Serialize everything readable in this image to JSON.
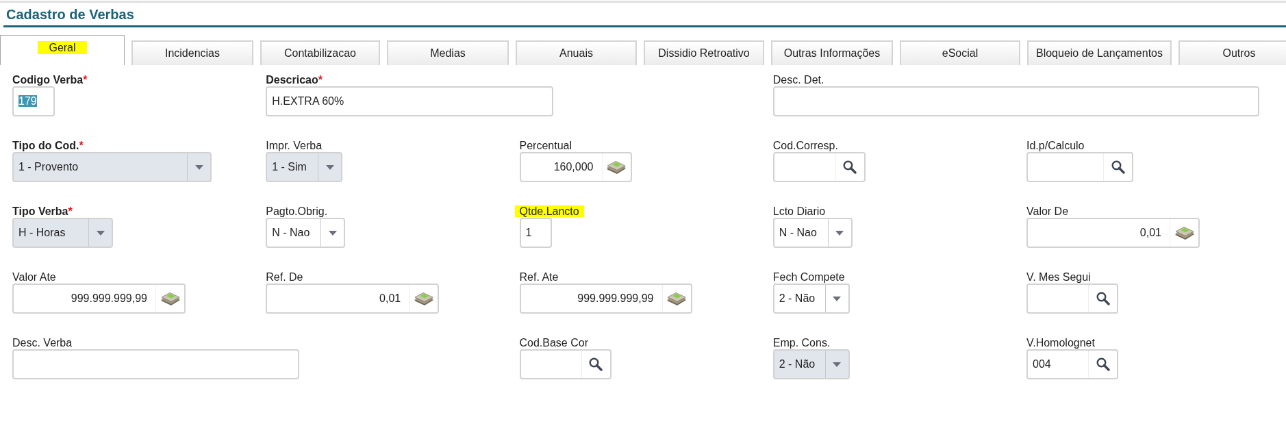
{
  "title": "Cadastro de Verbas",
  "tabs": [
    {
      "label": "Geral",
      "selected": true,
      "highlighted": true
    },
    {
      "label": "Incidencias",
      "selected": false,
      "highlighted": false
    },
    {
      "label": "Contabilizacao",
      "selected": false,
      "highlighted": false
    },
    {
      "label": "Medias",
      "selected": false,
      "highlighted": false
    },
    {
      "label": "Anuais",
      "selected": false,
      "highlighted": false
    },
    {
      "label": "Dissidio Retroativo",
      "selected": false,
      "highlighted": false
    },
    {
      "label": "Outras Informações",
      "selected": false,
      "highlighted": false
    },
    {
      "label": "eSocial",
      "selected": false,
      "highlighted": false
    },
    {
      "label": "Bloqueio de Lançamentos",
      "selected": false,
      "highlighted": false
    },
    {
      "label": "Outros",
      "selected": false,
      "highlighted": false
    }
  ],
  "form": {
    "fields": [
      {
        "kind": "text",
        "label": "Codigo Verba",
        "required": true,
        "required_mark": "*",
        "highlighted": false,
        "disabled": false,
        "value": "179",
        "value_selected": true
      },
      {
        "kind": "text",
        "label": "Descricao",
        "required": true,
        "required_mark": "*",
        "highlighted": false,
        "disabled": false,
        "value": "H.EXTRA 60%",
        "value_selected": false
      },
      {
        "kind": "text",
        "label": "Desc. Det.",
        "required": false,
        "highlighted": false,
        "disabled": false
      },
      {
        "kind": "select",
        "label": "Tipo do Cod.",
        "required": true,
        "required_mark": "*",
        "highlighted": false,
        "disabled": true,
        "value": "1 - Provento",
        "value_selected": false
      },
      {
        "kind": "select",
        "label": "Impr. Verba",
        "required": false,
        "highlighted": false,
        "disabled": true,
        "value": "1 - Sim",
        "value_selected": false
      },
      {
        "kind": "money",
        "label": "Percentual",
        "required": false,
        "highlighted": false,
        "disabled": false,
        "value": "160,000",
        "value_selected": false
      },
      {
        "kind": "lookup",
        "label": "Cod.Corresp.",
        "required": false,
        "highlighted": false,
        "disabled": false
      },
      {
        "kind": "lookup",
        "label": "Id.p/Calculo",
        "required": false,
        "highlighted": false,
        "disabled": false
      },
      {
        "kind": "select",
        "label": "Tipo Verba",
        "required": true,
        "required_mark": "*",
        "highlighted": false,
        "disabled": true,
        "value": "H - Horas",
        "value_selected": false
      },
      {
        "kind": "select",
        "label": "Pagto.Obrig.",
        "required": false,
        "highlighted": false,
        "disabled": false,
        "value": "N - Nao",
        "value_selected": false
      },
      {
        "kind": "text",
        "label": "Qtde.Lancto",
        "required": false,
        "highlighted": true,
        "disabled": false,
        "value": "1",
        "value_selected": false
      },
      {
        "kind": "select",
        "label": "Lcto Diario",
        "required": false,
        "highlighted": false,
        "disabled": false,
        "value": "N - Nao",
        "value_selected": false
      },
      {
        "kind": "money",
        "label": "Valor De",
        "required": false,
        "highlighted": false,
        "disabled": false,
        "value": "0,01",
        "value_selected": false
      },
      {
        "kind": "money",
        "label": "Valor Ate",
        "required": false,
        "highlighted": false,
        "disabled": false,
        "value": "999.999.999,99",
        "value_selected": false
      },
      {
        "kind": "money",
        "label": "Ref. De",
        "required": false,
        "highlighted": false,
        "disabled": false,
        "value": "0,01",
        "value_selected": false
      },
      {
        "kind": "money",
        "label": "Ref. Ate",
        "required": false,
        "highlighted": false,
        "disabled": false,
        "value": "999.999.999,99",
        "value_selected": false
      },
      {
        "kind": "select",
        "label": "Fech Compete",
        "required": false,
        "highlighted": false,
        "disabled": false,
        "value": "2 - Não",
        "value_selected": false
      },
      {
        "kind": "lookup",
        "label": "V. Mes Segui",
        "required": false,
        "highlighted": false,
        "disabled": false
      },
      {
        "kind": "text",
        "label": "Desc. Verba",
        "required": false,
        "highlighted": false,
        "disabled": false
      },
      {
        "kind": "lookup",
        "label": "Cod.Base Cor",
        "required": false,
        "highlighted": false,
        "disabled": false
      },
      {
        "kind": "select",
        "label": "Emp. Cons.",
        "required": false,
        "highlighted": false,
        "disabled": true,
        "value": "2 - Não",
        "value_selected": false
      },
      {
        "kind": "lookup",
        "label": "V.Homolognet",
        "required": false,
        "highlighted": false,
        "disabled": false,
        "value": "004",
        "value_selected": false
      }
    ]
  }
}
